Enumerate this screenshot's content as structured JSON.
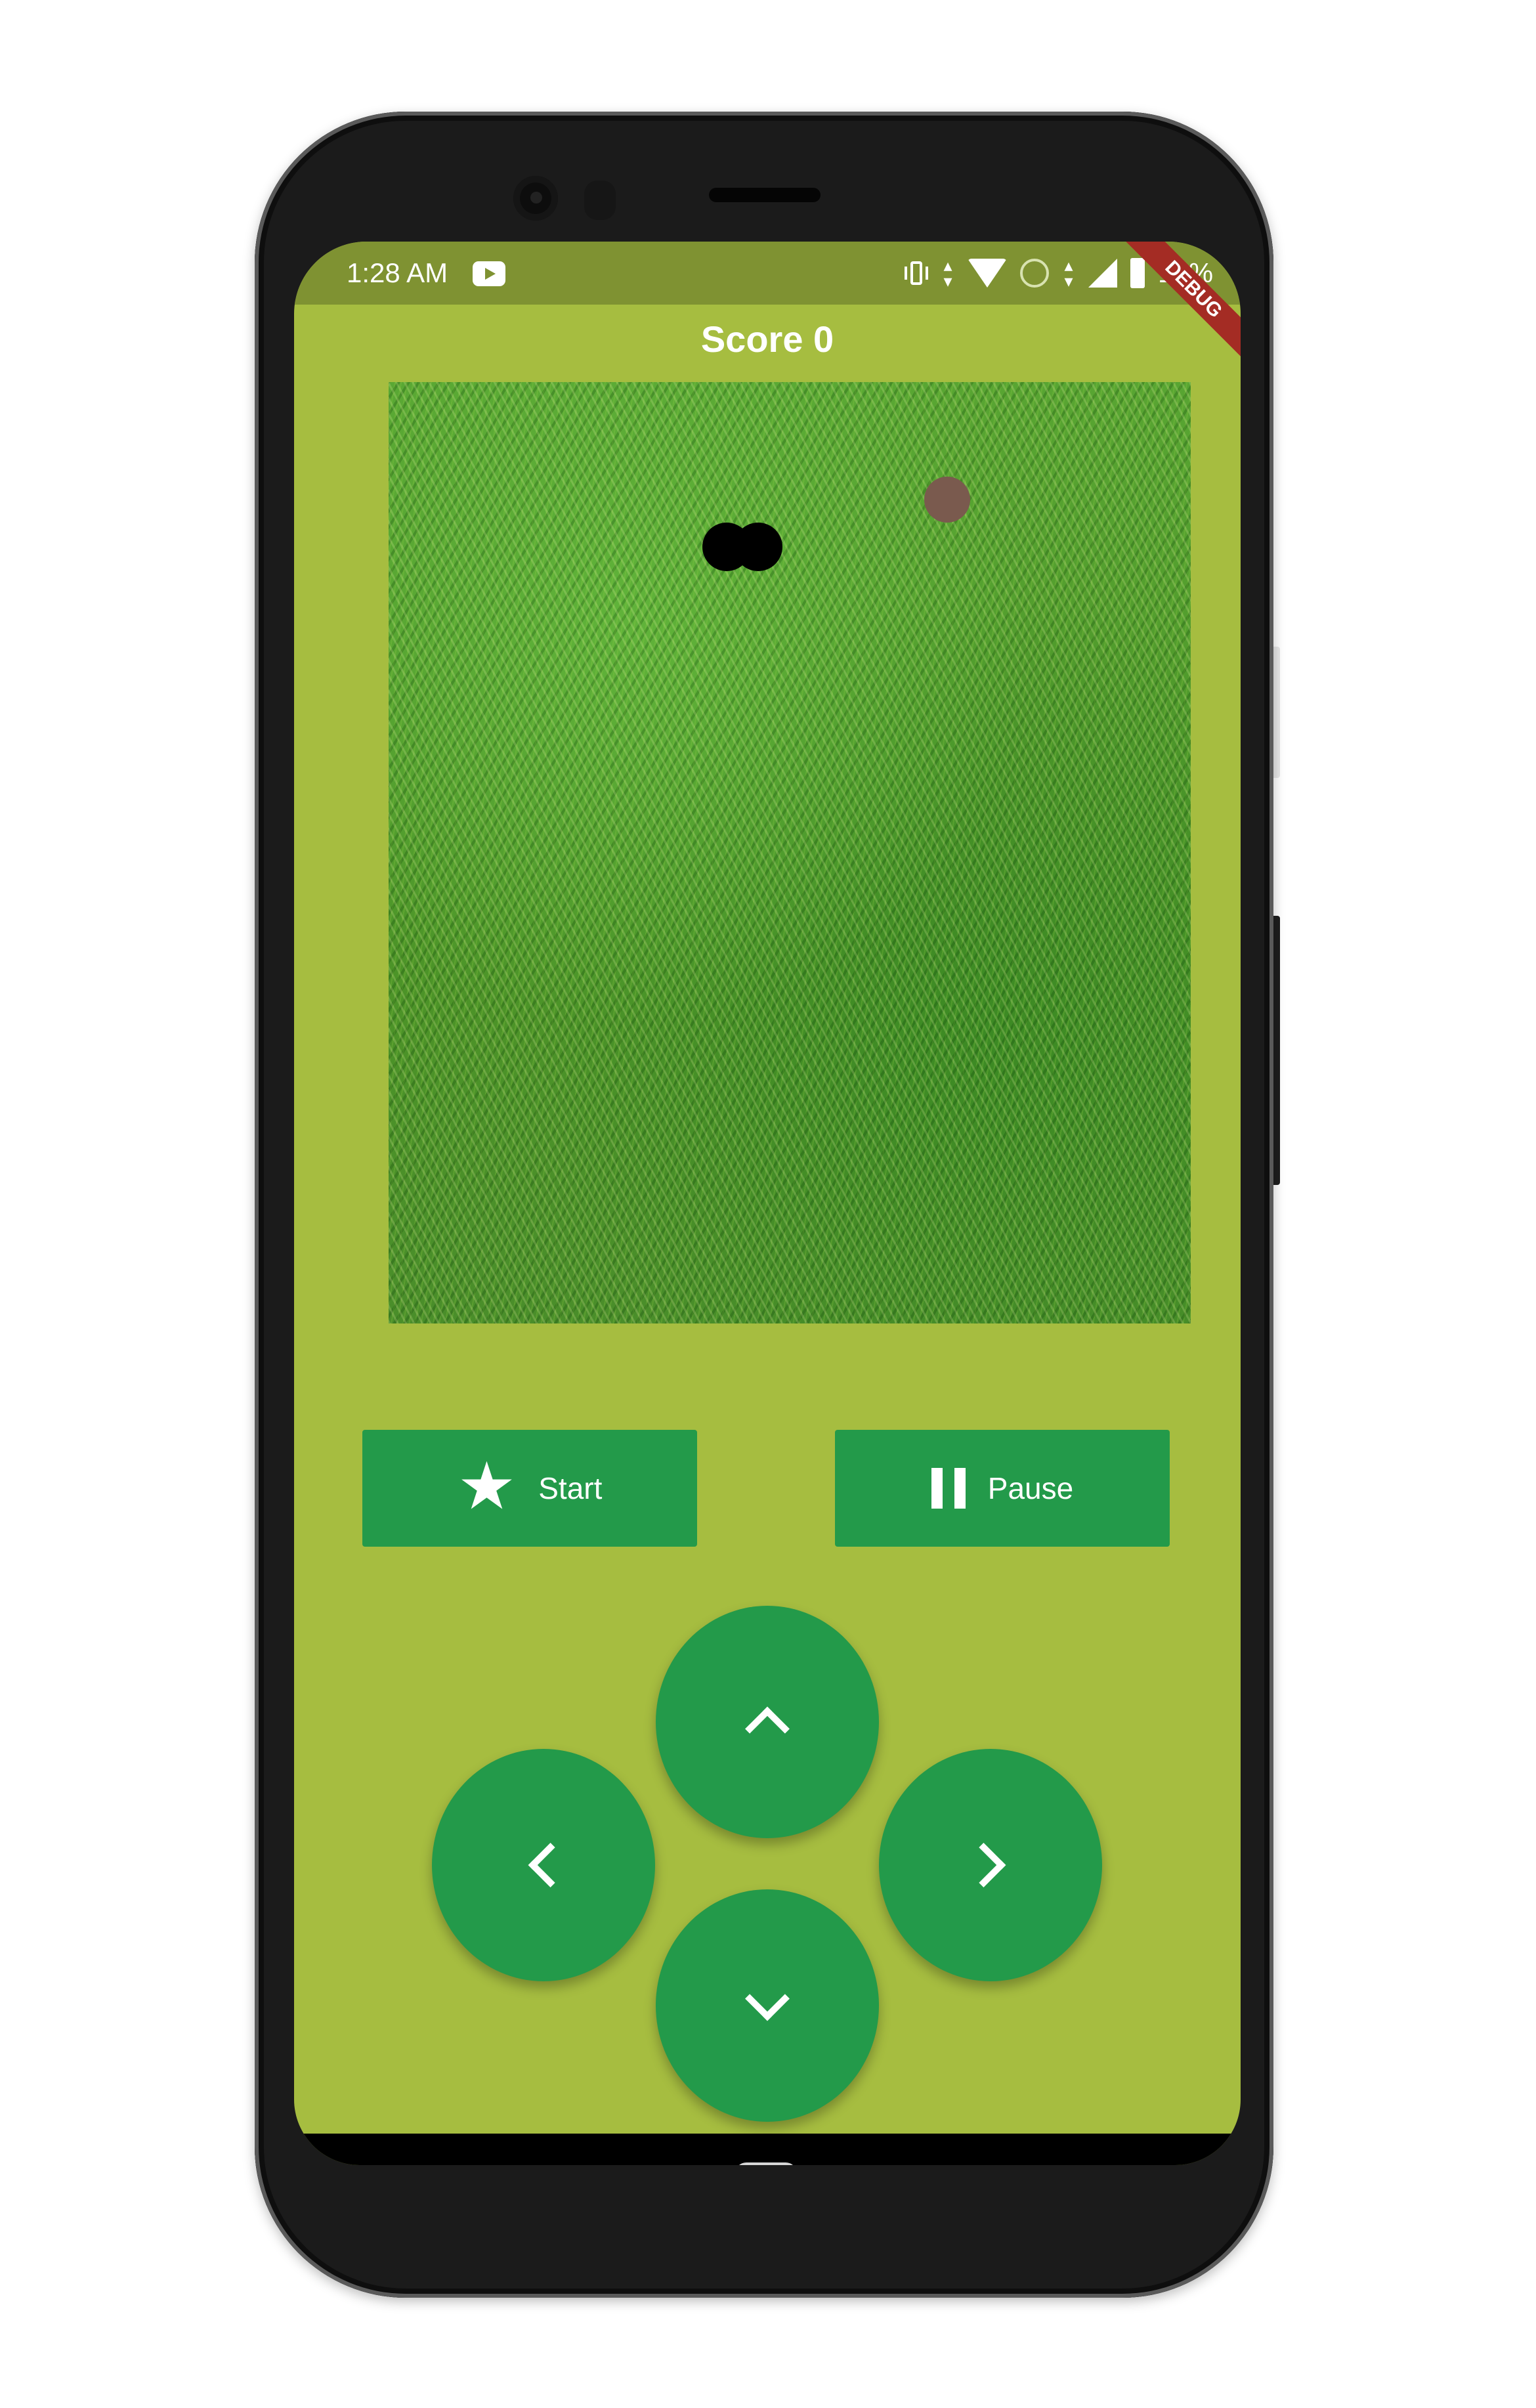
{
  "status_bar": {
    "time": "1:28 AM",
    "battery_text": "19%",
    "icons": [
      "youtube-icon",
      "vibrate-icon",
      "data-arrows-icon",
      "wifi-icon",
      "hotspot-icon",
      "signal-icon",
      "battery-icon"
    ]
  },
  "debug_banner": "DEBUG",
  "header": {
    "score_label": "Score 0"
  },
  "board": {
    "background": "grass texture",
    "snake_color": "#000000",
    "food_color": "#7a5a4e"
  },
  "controls": {
    "start_label": "Start",
    "start_icon": "star-icon",
    "pause_label": "Pause",
    "pause_icon": "pause-icon",
    "dpad": [
      "up-arrow-icon",
      "left-arrow-icon",
      "right-arrow-icon",
      "down-arrow-icon"
    ]
  },
  "nav_bar": {
    "back_glyph": "‹"
  },
  "colors": {
    "app_background": "#a6bd40",
    "status_bar": "#7f9232",
    "button": "#239a4a",
    "debug_banner": "#a42c24"
  }
}
